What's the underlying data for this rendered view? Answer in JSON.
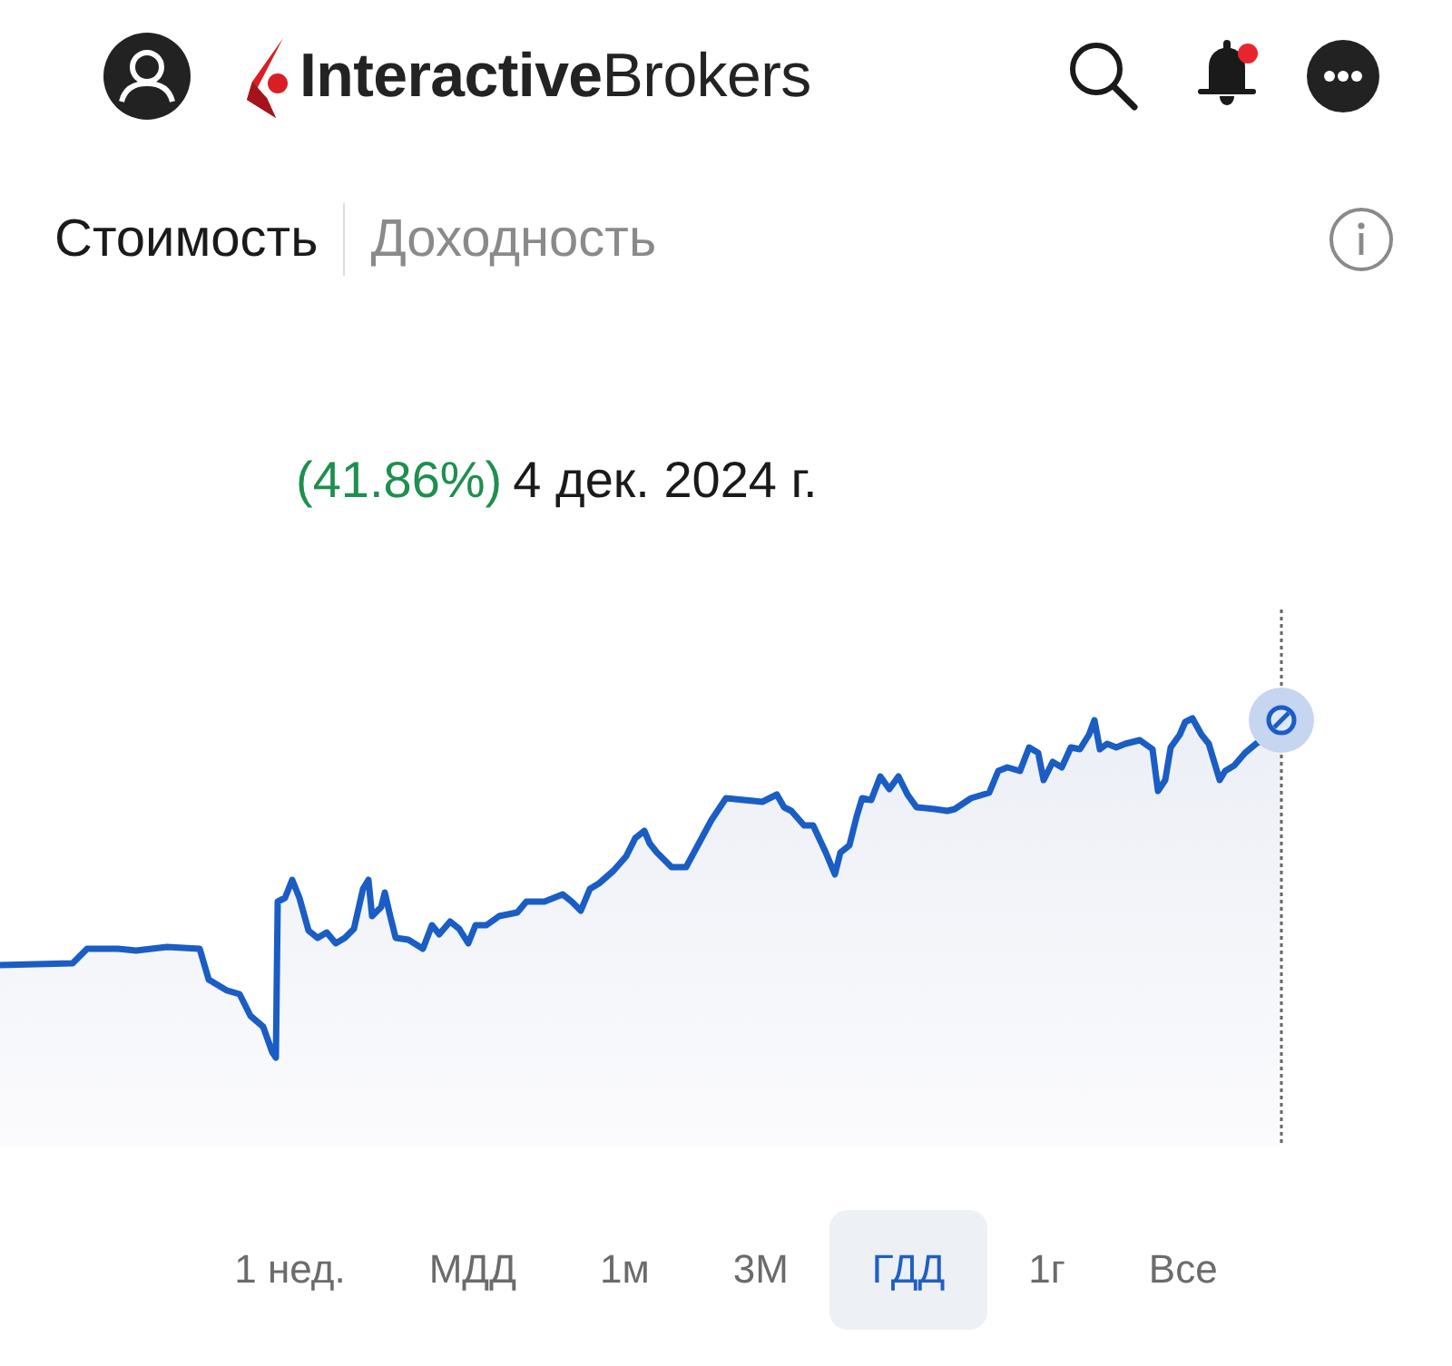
{
  "header": {
    "logo": "**Interactive**Brokers",
    "notifications": {
      "unread": true
    }
  },
  "tabs": [
    {
      "label": "Стоимость",
      "selected": true
    },
    {
      "label": "Доходность",
      "selected": false
    }
  ],
  "tooltip": {
    "change": "(41.86%)",
    "positive": true,
    "date": "4 дек. 2024 г."
  },
  "ranges": [
    {
      "label": "1 нед.",
      "selected": false
    },
    {
      "label": "МДД",
      "selected": false
    },
    {
      "label": "1м",
      "selected": false
    },
    {
      "label": "3М",
      "selected": false
    },
    {
      "label": "ГДД",
      "selected": true
    },
    {
      "label": "1г",
      "selected": false
    },
    {
      "label": "Все",
      "selected": false
    }
  ]
}
